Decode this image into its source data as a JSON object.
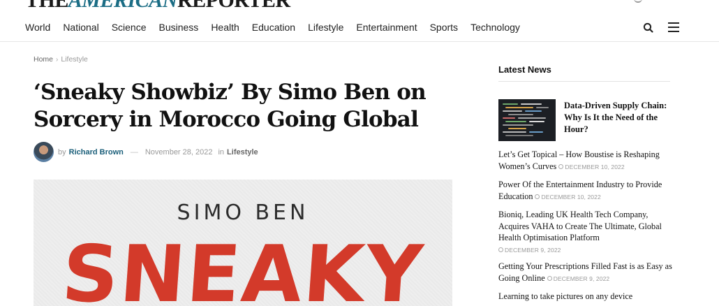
{
  "site": {
    "masthead_pre": "THE",
    "masthead_mid": "AMERICAN",
    "masthead_post": "REPORTER"
  },
  "nav": {
    "items": [
      "World",
      "National",
      "Science",
      "Business",
      "Health",
      "Education",
      "Lifestyle",
      "Entertainment",
      "Sports",
      "Technology"
    ],
    "search_icon": "search-icon",
    "menu_icon": "hamburger-menu-icon"
  },
  "breadcrumb": {
    "home": "Home",
    "separator": "›",
    "current": "Lifestyle"
  },
  "article": {
    "title": "‘Sneaky Showbiz’ By Simo Ben on Sorcery in Morocco Going Global",
    "by_label": "by",
    "author": "Richard Brown",
    "dash": "—",
    "date": "November 28, 2022",
    "in_label": "in",
    "category": "Lifestyle",
    "image_artist": "SIMO BEN",
    "image_title": "SNEAKY"
  },
  "sidebar": {
    "title": "Latest News",
    "featured": {
      "title": "Data-Driven Supply Chain: Why Is It the Need of the Hour?"
    },
    "items": [
      {
        "title": "Let’s Get Topical – How Boustise is Reshaping Women’s Curves",
        "date": "DECEMBER 10, 2022"
      },
      {
        "title": "Power Of the Entertainment Industry to Provide Education",
        "date": "DECEMBER 10, 2022"
      },
      {
        "title": "Bioniq, Leading UK Health Tech Company, Acquires VAHA to Create The Ultimate, Global Health Optimisation Platform",
        "date": "DECEMBER 9, 2022"
      },
      {
        "title": "Getting Your Prescriptions Filled Fast is as Easy as Going Online",
        "date": "DECEMBER 9, 2022"
      },
      {
        "title": "Learning to take pictures on any device",
        "date": ""
      }
    ]
  },
  "colors": {
    "brand": "#1b6d85",
    "author_link": "#1b5f7a",
    "hero_red": "#d33a2a"
  }
}
